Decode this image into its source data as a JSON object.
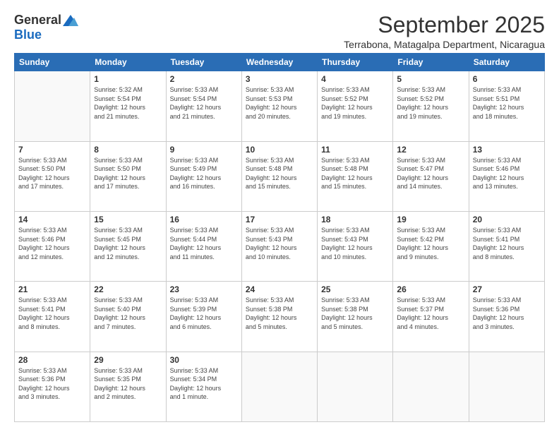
{
  "header": {
    "logo_general": "General",
    "logo_blue": "Blue",
    "month_title": "September 2025",
    "subtitle": "Terrabona, Matagalpa Department, Nicaragua"
  },
  "days_of_week": [
    "Sunday",
    "Monday",
    "Tuesday",
    "Wednesday",
    "Thursday",
    "Friday",
    "Saturday"
  ],
  "weeks": [
    [
      {
        "day": "",
        "info": ""
      },
      {
        "day": "1",
        "info": "Sunrise: 5:32 AM\nSunset: 5:54 PM\nDaylight: 12 hours\nand 21 minutes."
      },
      {
        "day": "2",
        "info": "Sunrise: 5:33 AM\nSunset: 5:54 PM\nDaylight: 12 hours\nand 21 minutes."
      },
      {
        "day": "3",
        "info": "Sunrise: 5:33 AM\nSunset: 5:53 PM\nDaylight: 12 hours\nand 20 minutes."
      },
      {
        "day": "4",
        "info": "Sunrise: 5:33 AM\nSunset: 5:52 PM\nDaylight: 12 hours\nand 19 minutes."
      },
      {
        "day": "5",
        "info": "Sunrise: 5:33 AM\nSunset: 5:52 PM\nDaylight: 12 hours\nand 19 minutes."
      },
      {
        "day": "6",
        "info": "Sunrise: 5:33 AM\nSunset: 5:51 PM\nDaylight: 12 hours\nand 18 minutes."
      }
    ],
    [
      {
        "day": "7",
        "info": "Sunrise: 5:33 AM\nSunset: 5:50 PM\nDaylight: 12 hours\nand 17 minutes."
      },
      {
        "day": "8",
        "info": "Sunrise: 5:33 AM\nSunset: 5:50 PM\nDaylight: 12 hours\nand 17 minutes."
      },
      {
        "day": "9",
        "info": "Sunrise: 5:33 AM\nSunset: 5:49 PM\nDaylight: 12 hours\nand 16 minutes."
      },
      {
        "day": "10",
        "info": "Sunrise: 5:33 AM\nSunset: 5:48 PM\nDaylight: 12 hours\nand 15 minutes."
      },
      {
        "day": "11",
        "info": "Sunrise: 5:33 AM\nSunset: 5:48 PM\nDaylight: 12 hours\nand 15 minutes."
      },
      {
        "day": "12",
        "info": "Sunrise: 5:33 AM\nSunset: 5:47 PM\nDaylight: 12 hours\nand 14 minutes."
      },
      {
        "day": "13",
        "info": "Sunrise: 5:33 AM\nSunset: 5:46 PM\nDaylight: 12 hours\nand 13 minutes."
      }
    ],
    [
      {
        "day": "14",
        "info": "Sunrise: 5:33 AM\nSunset: 5:46 PM\nDaylight: 12 hours\nand 12 minutes."
      },
      {
        "day": "15",
        "info": "Sunrise: 5:33 AM\nSunset: 5:45 PM\nDaylight: 12 hours\nand 12 minutes."
      },
      {
        "day": "16",
        "info": "Sunrise: 5:33 AM\nSunset: 5:44 PM\nDaylight: 12 hours\nand 11 minutes."
      },
      {
        "day": "17",
        "info": "Sunrise: 5:33 AM\nSunset: 5:43 PM\nDaylight: 12 hours\nand 10 minutes."
      },
      {
        "day": "18",
        "info": "Sunrise: 5:33 AM\nSunset: 5:43 PM\nDaylight: 12 hours\nand 10 minutes."
      },
      {
        "day": "19",
        "info": "Sunrise: 5:33 AM\nSunset: 5:42 PM\nDaylight: 12 hours\nand 9 minutes."
      },
      {
        "day": "20",
        "info": "Sunrise: 5:33 AM\nSunset: 5:41 PM\nDaylight: 12 hours\nand 8 minutes."
      }
    ],
    [
      {
        "day": "21",
        "info": "Sunrise: 5:33 AM\nSunset: 5:41 PM\nDaylight: 12 hours\nand 8 minutes."
      },
      {
        "day": "22",
        "info": "Sunrise: 5:33 AM\nSunset: 5:40 PM\nDaylight: 12 hours\nand 7 minutes."
      },
      {
        "day": "23",
        "info": "Sunrise: 5:33 AM\nSunset: 5:39 PM\nDaylight: 12 hours\nand 6 minutes."
      },
      {
        "day": "24",
        "info": "Sunrise: 5:33 AM\nSunset: 5:38 PM\nDaylight: 12 hours\nand 5 minutes."
      },
      {
        "day": "25",
        "info": "Sunrise: 5:33 AM\nSunset: 5:38 PM\nDaylight: 12 hours\nand 5 minutes."
      },
      {
        "day": "26",
        "info": "Sunrise: 5:33 AM\nSunset: 5:37 PM\nDaylight: 12 hours\nand 4 minutes."
      },
      {
        "day": "27",
        "info": "Sunrise: 5:33 AM\nSunset: 5:36 PM\nDaylight: 12 hours\nand 3 minutes."
      }
    ],
    [
      {
        "day": "28",
        "info": "Sunrise: 5:33 AM\nSunset: 5:36 PM\nDaylight: 12 hours\nand 3 minutes."
      },
      {
        "day": "29",
        "info": "Sunrise: 5:33 AM\nSunset: 5:35 PM\nDaylight: 12 hours\nand 2 minutes."
      },
      {
        "day": "30",
        "info": "Sunrise: 5:33 AM\nSunset: 5:34 PM\nDaylight: 12 hours\nand 1 minute."
      },
      {
        "day": "",
        "info": ""
      },
      {
        "day": "",
        "info": ""
      },
      {
        "day": "",
        "info": ""
      },
      {
        "day": "",
        "info": ""
      }
    ]
  ]
}
